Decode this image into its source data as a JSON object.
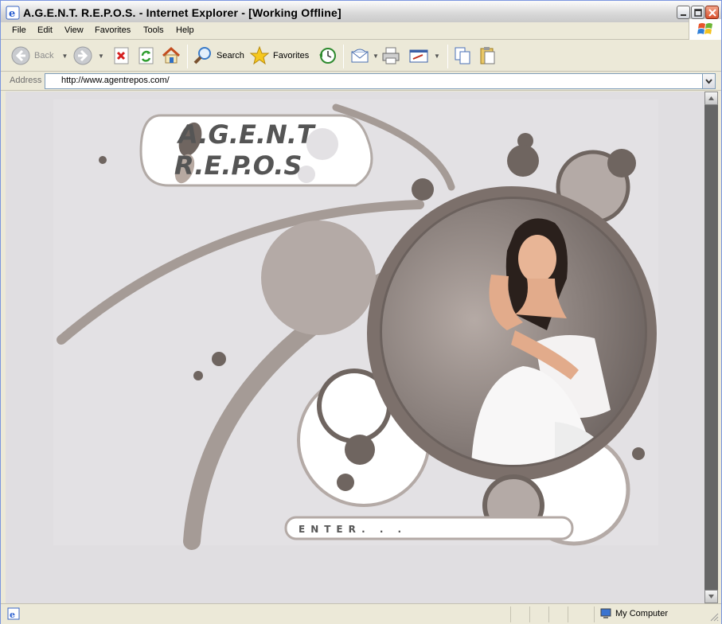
{
  "window": {
    "title": "A.G.E.N.T. R.E.P.O.S. - Internet Explorer - [Working Offline]"
  },
  "menu": {
    "items": [
      "File",
      "Edit",
      "View",
      "Favorites",
      "Tools",
      "Help"
    ]
  },
  "toolbar": {
    "back_label": "Back",
    "search_label": "Search",
    "favorites_label": "Favorites"
  },
  "address": {
    "label": "Address",
    "url": "http://www.agentrepos.com/"
  },
  "page": {
    "logo_line1": "A.G.E.N.T",
    "logo_line2": "R.E.P.O.S",
    "enter_label": "ENTER. . ."
  },
  "status": {
    "zone": "My Computer"
  },
  "colors": {
    "accent_dark": "#6f6560",
    "accent_mid": "#a59b96",
    "content_bg": "#e0dee1"
  }
}
